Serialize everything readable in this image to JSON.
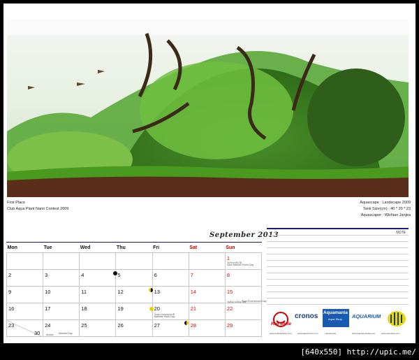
{
  "photo": {
    "description": ""
  },
  "caption": {
    "left_line1": "First Place",
    "left_line2": "Club Aqua Plant Nano Contest 2009",
    "right_line1": "Aquascape : Landscape 2009",
    "right_line2": "Tank Size(cm) : 40 * 20 * 23",
    "right_line3": "Aquascaper : Wichian Janjira"
  },
  "calendar": {
    "title": "September 2013",
    "headers": [
      "Mon",
      "Tue",
      "Wed",
      "Thu",
      "Fri",
      "Sat",
      "Sun"
    ],
    "weeks": [
      [
        "",
        "",
        "",
        "",
        "",
        "",
        "1"
      ],
      [
        "2",
        "3",
        "4",
        "5",
        "6",
        "7",
        "8"
      ],
      [
        "9",
        "10",
        "11",
        "12",
        "13",
        "14",
        "15"
      ],
      [
        "16",
        "17",
        "18",
        "19",
        "20",
        "21",
        "22"
      ],
      [
        "23",
        "24",
        "25",
        "26",
        "27",
        "28",
        "29"
      ]
    ],
    "extra_day": "30",
    "notes": {
      "sun1_a": "วันรักษาต้นไม้",
      "sun1_b": "Save Natural Forest Day",
      "sun15": "วันสิ่งแวดล้อมไทย",
      "sun15_b": "Thai Environment Day",
      "fri20_a": "วันเยาวชนแห่งชาติ",
      "fri20_b": "National Youth Day",
      "mon23": "Auslan",
      "tue24": "Mahidol Day"
    }
  },
  "notes_panel": {
    "label": "NOTE"
  },
  "sponsors": {
    "s1": "Red Smile",
    "s2": "cronos",
    "s3": "Aquamania",
    "s3_sub": "Aqua Shop",
    "s4": "AQUARIUM"
  },
  "footer": {
    "tag": "[640x550] http://upic.me/"
  },
  "colors": {
    "accent": "#1a1a8a",
    "weekend": "#d00000"
  }
}
